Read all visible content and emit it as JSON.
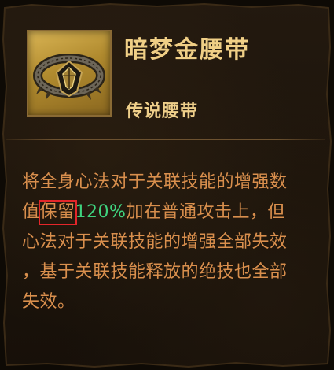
{
  "item": {
    "name": "暗梦金腰带",
    "type": "传说腰带",
    "icon": "gold-belt-icon"
  },
  "description": {
    "line1": "将全身心法对于关联技能的增强数",
    "line2_pre": "值",
    "line2_highlight": "保留",
    "line2_value": "120%",
    "line2_post": "加在普通攻击上，但",
    "line3": "心法对于关联技能的增强全部失效",
    "line4": "，基于关联技能释放的绝技也全部",
    "line5": "失效。"
  },
  "colors": {
    "title": "#f0cf86",
    "description": "#d98f4d",
    "value": "#3fd27e",
    "highlight_border": "#e4262a",
    "icon_background": "#c9a33f"
  }
}
